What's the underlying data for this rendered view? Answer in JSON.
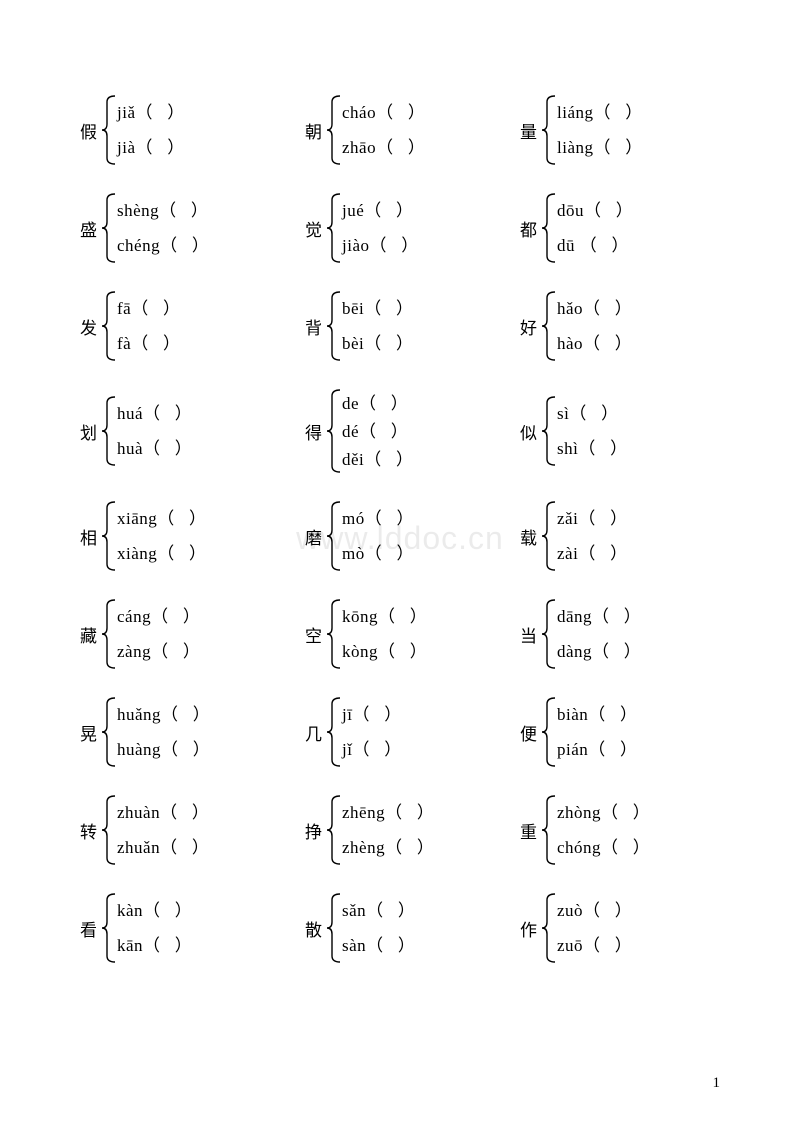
{
  "watermark": "www.lddoc.cn",
  "page_number": "1",
  "rows": [
    [
      {
        "char": "假",
        "items": [
          "jiǎ（   ）",
          "jià（   ）"
        ]
      },
      {
        "char": "朝",
        "items": [
          "cháo（   ）",
          "zhāo（   ）"
        ]
      },
      {
        "char": "量",
        "items": [
          "liáng（   ）",
          "liàng（   ）"
        ]
      }
    ],
    [
      {
        "char": "盛",
        "items": [
          "shèng（   ）",
          "chéng（   ）"
        ]
      },
      {
        "char": "觉",
        "items": [
          "jué（   ）",
          "jiào（   ）"
        ]
      },
      {
        "char": "都",
        "items": [
          "dōu（   ）",
          "dū （   ）"
        ]
      }
    ],
    [
      {
        "char": "发",
        "items": [
          "fā（   ）",
          "fà（   ）"
        ]
      },
      {
        "char": "背",
        "items": [
          "bēi（   ）",
          "bèi（   ）"
        ]
      },
      {
        "char": "好",
        "items": [
          "hǎo（   ）",
          "hào（   ）"
        ]
      }
    ],
    [
      {
        "char": "划",
        "items": [
          "huá（   ）",
          "huà（   ）"
        ]
      },
      {
        "char": "得",
        "items": [
          "de（   ）",
          "dé（   ）",
          "děi（   ）"
        ]
      },
      {
        "char": "似",
        "items": [
          "sì（   ）",
          "shì（   ）"
        ]
      }
    ],
    [
      {
        "char": "相",
        "items": [
          "xiāng（   ）",
          "xiàng（   ）"
        ]
      },
      {
        "char": "磨",
        "items": [
          "mó（   ）",
          "mò（   ）"
        ]
      },
      {
        "char": "载",
        "items": [
          "zǎi（   ）",
          "zài（   ）"
        ]
      }
    ],
    [
      {
        "char": "藏",
        "items": [
          "cáng（   ）",
          "zàng（   ）"
        ]
      },
      {
        "char": "空",
        "items": [
          "kōng（   ）",
          "kòng（   ）"
        ]
      },
      {
        "char": "当",
        "items": [
          "dāng（   ）",
          "dàng（   ）"
        ]
      }
    ],
    [
      {
        "char": "晃",
        "items": [
          "huǎng（   ）",
          "huàng（   ）"
        ]
      },
      {
        "char": "几",
        "items": [
          "jī（   ）",
          "jǐ（   ）"
        ]
      },
      {
        "char": "便",
        "items": [
          "biàn（   ）",
          "pián（   ）"
        ]
      }
    ],
    [
      {
        "char": "转",
        "items": [
          "zhuàn（   ）",
          "zhuǎn（   ）"
        ]
      },
      {
        "char": "挣",
        "items": [
          "zhēng（   ）",
          "zhèng（   ）"
        ]
      },
      {
        "char": "重",
        "items": [
          "zhòng（   ）",
          "chóng（   ）"
        ]
      }
    ],
    [
      {
        "char": "看",
        "items": [
          "kàn（   ）",
          "kān（   ）"
        ]
      },
      {
        "char": "散",
        "items": [
          "sǎn（   ）",
          "sàn（   ）"
        ]
      },
      {
        "char": "作",
        "items": [
          "zuò（   ）",
          "zuō（   ）"
        ]
      }
    ]
  ]
}
